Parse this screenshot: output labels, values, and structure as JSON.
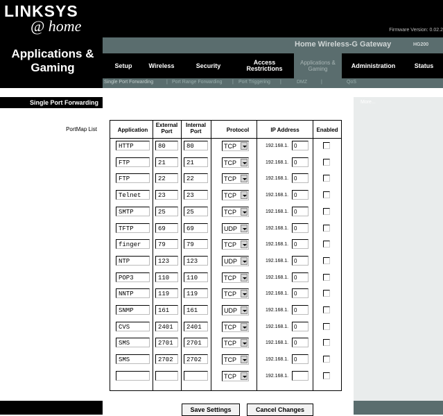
{
  "brand": {
    "name": "LINKSYS",
    "sub": "@ home"
  },
  "firmware": "Firmware Version: 0.02.2",
  "section_title": "Applications & Gaming",
  "gateway_name": "Home Wireless-G Gateway",
  "model": "HG200",
  "tabs": [
    "Setup",
    "Wireless",
    "Security",
    "Access Restrictions",
    "Applications & Gaming",
    "Administration",
    "Status"
  ],
  "subtabs": [
    "Single Port Forwarding",
    "Port Range Forwarding",
    "Port Triggering",
    "DMZ",
    "QoS"
  ],
  "left_label": "Single Port Forwarding",
  "portmap_label": "PortMap List",
  "more_link": "More...",
  "columns": [
    "Application",
    "External Port",
    "Internal Port",
    "Protocol",
    "IP Address",
    "Enabled"
  ],
  "ip_prefix": "192.168.1.",
  "rows": [
    {
      "app": "HTTP",
      "ext": "80",
      "int": "80",
      "proto": "TCP",
      "ip": "0"
    },
    {
      "app": "FTP",
      "ext": "21",
      "int": "21",
      "proto": "TCP",
      "ip": "0"
    },
    {
      "app": "FTP",
      "ext": "22",
      "int": "22",
      "proto": "TCP",
      "ip": "0"
    },
    {
      "app": "Telnet",
      "ext": "23",
      "int": "23",
      "proto": "TCP",
      "ip": "0"
    },
    {
      "app": "SMTP",
      "ext": "25",
      "int": "25",
      "proto": "TCP",
      "ip": "0"
    },
    {
      "app": "TFTP",
      "ext": "69",
      "int": "69",
      "proto": "UDP",
      "ip": "0"
    },
    {
      "app": "finger",
      "ext": "79",
      "int": "79",
      "proto": "TCP",
      "ip": "0"
    },
    {
      "app": "NTP",
      "ext": "123",
      "int": "123",
      "proto": "UDP",
      "ip": "0"
    },
    {
      "app": "POP3",
      "ext": "110",
      "int": "110",
      "proto": "TCP",
      "ip": "0"
    },
    {
      "app": "NNTP",
      "ext": "119",
      "int": "119",
      "proto": "TCP",
      "ip": "0"
    },
    {
      "app": "SNMP",
      "ext": "161",
      "int": "161",
      "proto": "UDP",
      "ip": "0"
    },
    {
      "app": "CVS",
      "ext": "2401",
      "int": "2401",
      "proto": "TCP",
      "ip": "0"
    },
    {
      "app": "SMS",
      "ext": "2701",
      "int": "2701",
      "proto": "TCP",
      "ip": "0"
    },
    {
      "app": "SMS",
      "ext": "2702",
      "int": "2702",
      "proto": "TCP",
      "ip": "0"
    },
    {
      "app": "",
      "ext": "",
      "int": "",
      "proto": "TCP",
      "ip": ""
    }
  ],
  "buttons": {
    "save": "Save Settings",
    "cancel": "Cancel Changes"
  }
}
